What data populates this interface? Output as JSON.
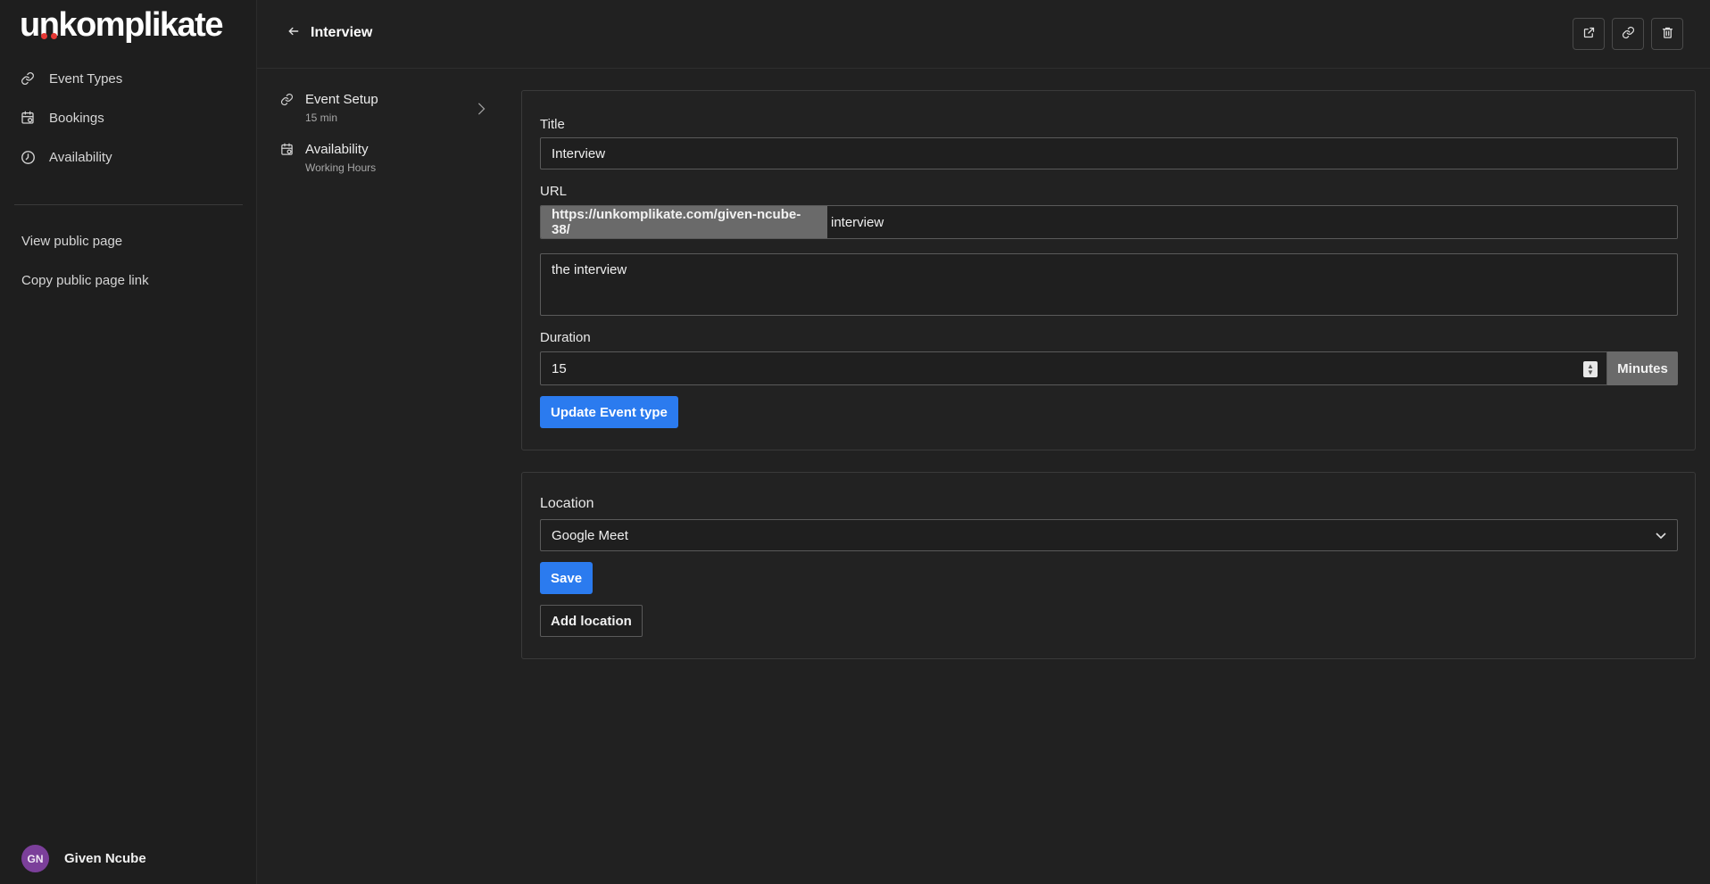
{
  "app": {
    "logo_text_before": "u",
    "logo_text_dots": "nk",
    "logo_text_after": "omplikate",
    "accent_color": "#2b7bef",
    "logo_dot_color": "#e53935"
  },
  "sidebar": {
    "items": [
      {
        "label": "Event Types",
        "icon": "link-icon"
      },
      {
        "label": "Bookings",
        "icon": "calendar-icon"
      },
      {
        "label": "Availability",
        "icon": "clock-icon"
      }
    ],
    "view_public_page": "View public page",
    "copy_public_link": "Copy public page link",
    "user": {
      "initials": "GN",
      "name": "Given Ncube",
      "avatar_color": "#7b3f9a"
    }
  },
  "header": {
    "title": "Interview",
    "actions": [
      {
        "name": "external-link-icon"
      },
      {
        "name": "link-icon"
      },
      {
        "name": "trash-icon"
      }
    ]
  },
  "subnav": {
    "items": [
      {
        "title": "Event Setup",
        "desc": "15 min",
        "icon": "link-icon"
      },
      {
        "title": "Availability",
        "desc": "Working Hours",
        "icon": "calendar-icon"
      }
    ]
  },
  "form": {
    "title_label": "Title",
    "title_value": "Interview",
    "url_label": "URL",
    "url_prefix": "https://unkomplikate.com/given-ncube-38/",
    "url_slug": "interview",
    "description_value": "the interview",
    "duration_label": "Duration",
    "duration_value": "15",
    "duration_unit": "Minutes",
    "submit_label": "Update Event type"
  },
  "location": {
    "label": "Location",
    "selected": "Google Meet",
    "save_label": "Save",
    "add_label": "Add location"
  }
}
